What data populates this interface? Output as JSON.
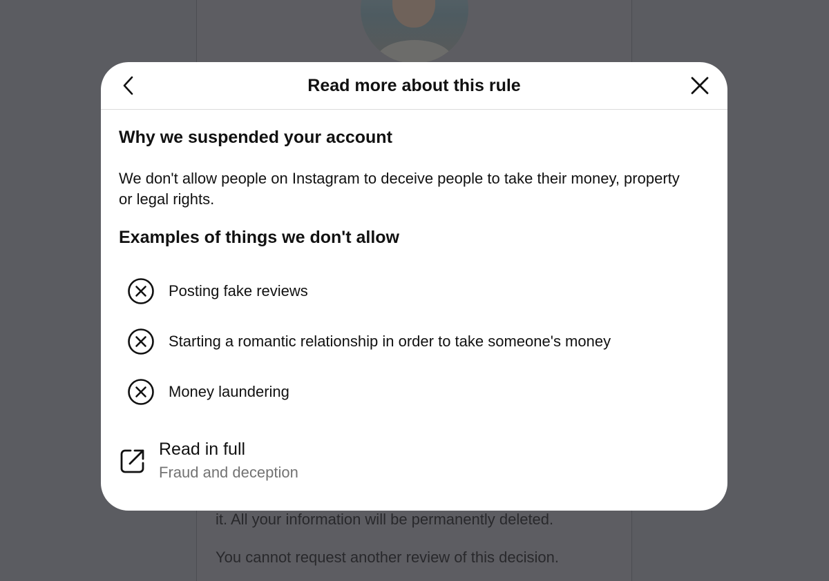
{
  "background": {
    "line1": "it. All your information will be permanently deleted.",
    "line2": "You cannot request another review of this decision."
  },
  "modal": {
    "title": "Read more about this rule",
    "back_icon": "chevron-left-icon",
    "close_icon": "close-icon",
    "section1_heading": "Why we suspended your account",
    "section1_text": "We don't allow people on Instagram to deceive people to take their money, property or legal rights.",
    "section2_heading": "Examples of things we don't allow",
    "examples": [
      {
        "icon": "circle-x-icon",
        "label": "Posting fake reviews"
      },
      {
        "icon": "circle-x-icon",
        "label": "Starting a romantic relationship in order to take someone's money"
      },
      {
        "icon": "circle-x-icon",
        "label": "Money laundering"
      }
    ],
    "read_full": {
      "icon": "external-link-icon",
      "title": "Read in full",
      "subtitle": "Fraud and deception"
    }
  }
}
